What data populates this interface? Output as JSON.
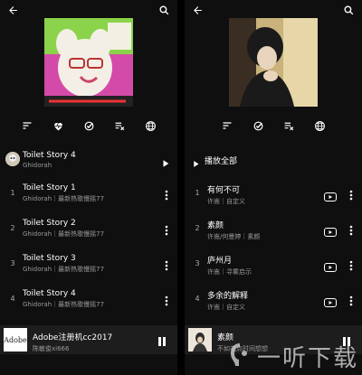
{
  "left": {
    "header": {
      "title": "Toilet Story 4",
      "subtitle": "Ghidorah"
    },
    "songs": [
      {
        "num": "1",
        "title": "Toilet Story 1",
        "subtitle": "Ghidorah｜最新热歌慢摇77"
      },
      {
        "num": "2",
        "title": "Toilet Story 2",
        "subtitle": "Ghidorah｜最新热歌慢摇77"
      },
      {
        "num": "3",
        "title": "Toilet Story 3",
        "subtitle": "Ghidorah｜最新热歌慢摇77"
      },
      {
        "num": "4",
        "title": "Toilet Story 4",
        "subtitle": "Ghidorah｜最新热歌慢摇77"
      }
    ],
    "miniplayer": {
      "title": "Adobe注册机cc2017",
      "subtitle": "陈敏俊xi666",
      "thumb_text": "Adobe"
    }
  },
  "right": {
    "play_all_label": "播放全部",
    "songs": [
      {
        "num": "1",
        "title": "有何不可",
        "subtitle": "许嵩｜自定义"
      },
      {
        "num": "2",
        "title": "素颜",
        "subtitle": "许嵩/何曼婷｜素颜"
      },
      {
        "num": "3",
        "title": "庐州月",
        "subtitle": "许嵩｜寻雾启示"
      },
      {
        "num": "4",
        "title": "多余的解释",
        "subtitle": "许嵩｜自定义"
      }
    ],
    "miniplayer": {
      "title": "素颜",
      "subtitle": "不如花点时间想想"
    }
  },
  "watermark": {
    "text": "一听下载"
  },
  "icons": {
    "back": "arrow-left-icon",
    "search": "search-icon",
    "sort": "sort-icon",
    "heart": "heart-pulse-icon",
    "check": "check-circle-icon",
    "clear": "clear-list-icon",
    "globe": "globe-icon",
    "play": "play-icon",
    "more": "more-vertical-icon",
    "youtube": "youtube-icon",
    "pause": "pause-icon"
  },
  "colors": {
    "background": "#0f0f0f",
    "miniplayer": "#1d1d1d",
    "secondary_text": "#9a9a9a"
  }
}
